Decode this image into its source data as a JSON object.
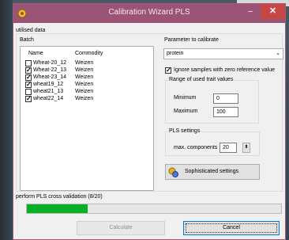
{
  "window": {
    "title": "Calibration Wizard PLS",
    "minimize": "–",
    "close": "✕"
  },
  "section_label": "utilised data",
  "batch": {
    "label": "Batch",
    "columns": [
      "Name",
      "Commodity"
    ],
    "rows": [
      {
        "name": "Wheat-20_12",
        "commodity": "Weizen",
        "checked": false
      },
      {
        "name": "Wheat-22_13",
        "commodity": "Weizen",
        "checked": true
      },
      {
        "name": "Wheat-23_14",
        "commodity": "Weizen",
        "checked": true
      },
      {
        "name": "wheat19_12",
        "commodity": "Weizen",
        "checked": true
      },
      {
        "name": "wheat21_13",
        "commodity": "Weizen",
        "checked": false
      },
      {
        "name": "wheat22_14",
        "commodity": "Weizen",
        "checked": true
      }
    ]
  },
  "parameter": {
    "label": "Parameter to calibrate",
    "value": "protein"
  },
  "ignore_zero": {
    "label": "Ignore samples with zero reference value",
    "checked": true
  },
  "range": {
    "label": "Range of used trait values",
    "min_label": "Minimum",
    "min_value": "0",
    "max_label": "Maximum",
    "max_value": "100"
  },
  "pls": {
    "label": "PLS settings",
    "components_label": "max. components",
    "components_value": "20"
  },
  "sophisticated_button": "Sophisticated settings",
  "status_text": "perform PLS cross validation (8/20)",
  "progress_fraction": 0.24,
  "buttons": {
    "calculate": "Calculate",
    "cancel": "Cancel"
  },
  "colors": {
    "titlebar": "#9b5475",
    "close": "#c74646",
    "progress": "#06b025"
  },
  "icons": {
    "app": "wizard-icon",
    "settings": "gears-icon"
  }
}
